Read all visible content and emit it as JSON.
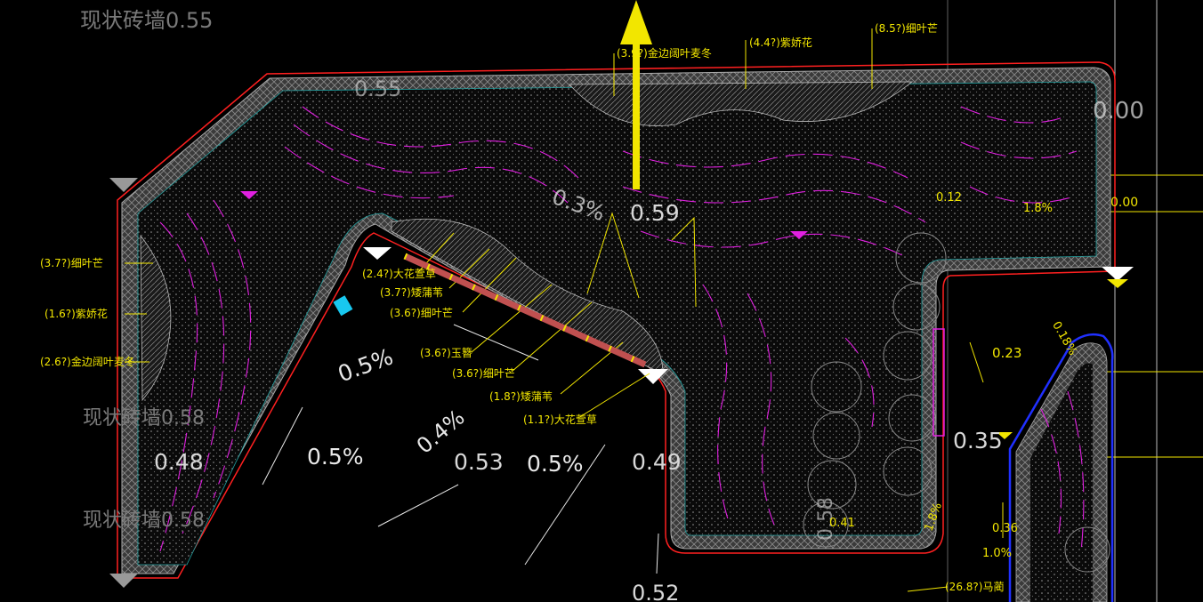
{
  "existing_wall_labels": [
    {
      "text": "现状砖墙0.55"
    },
    {
      "text": "现状砖墙0.58"
    },
    {
      "text": "现状砖墙0.58"
    }
  ],
  "elevations": [
    {
      "text": "0.55"
    },
    {
      "text": "0.59"
    },
    {
      "text": "0.00"
    },
    {
      "text": "0.00"
    },
    {
      "text": "0.48"
    },
    {
      "text": "0.53"
    },
    {
      "text": "0.49"
    },
    {
      "text": "0.35"
    },
    {
      "text": "0.52"
    },
    {
      "text": "0.58"
    }
  ],
  "slopes": [
    {
      "text": "0.3%"
    },
    {
      "text": "0.5%"
    },
    {
      "text": "0.4%"
    },
    {
      "text": "0.5%"
    },
    {
      "text": "0.5%"
    }
  ],
  "small_yellow_values": [
    {
      "text": "0.12"
    },
    {
      "text": "1.8%"
    },
    {
      "text": "0.23"
    },
    {
      "text": "0.18%"
    },
    {
      "text": "0.36"
    },
    {
      "text": "1.0%"
    },
    {
      "text": "0.41"
    },
    {
      "text": "1.8%"
    }
  ],
  "plant_labels_top": [
    {
      "text": "(3.9?)金边阔叶麦冬"
    },
    {
      "text": "(4.4?)紫娇花"
    },
    {
      "text": "(8.5?)细叶芒"
    }
  ],
  "plant_labels_left": [
    {
      "text": "(3.7?)细叶芒"
    },
    {
      "text": "(1.6?)紫娇花"
    },
    {
      "text": "(2.6?)金边阔叶麦冬"
    }
  ],
  "plant_labels_center": [
    {
      "text": "(2.4?)大花萱草"
    },
    {
      "text": "(3.7?)矮蒲苇"
    },
    {
      "text": "(3.6?)细叶芒"
    },
    {
      "text": "(3.6?)玉簪"
    },
    {
      "text": "(3.6?)细叶芒"
    },
    {
      "text": "(1.8?)矮蒲苇"
    },
    {
      "text": "(1.1?)大花萱草"
    }
  ],
  "plant_label_bottom": {
    "text": "(26.8?)马蔺"
  },
  "colors": {
    "background": "#000000",
    "boundary_red": "#ff2020",
    "paving_gray": "#8c8c8c",
    "contour_magenta": "#e020e0",
    "annotation_yellow": "#f2e600",
    "border_blue": "#2030ff",
    "text_white": "#d8d8d8"
  }
}
